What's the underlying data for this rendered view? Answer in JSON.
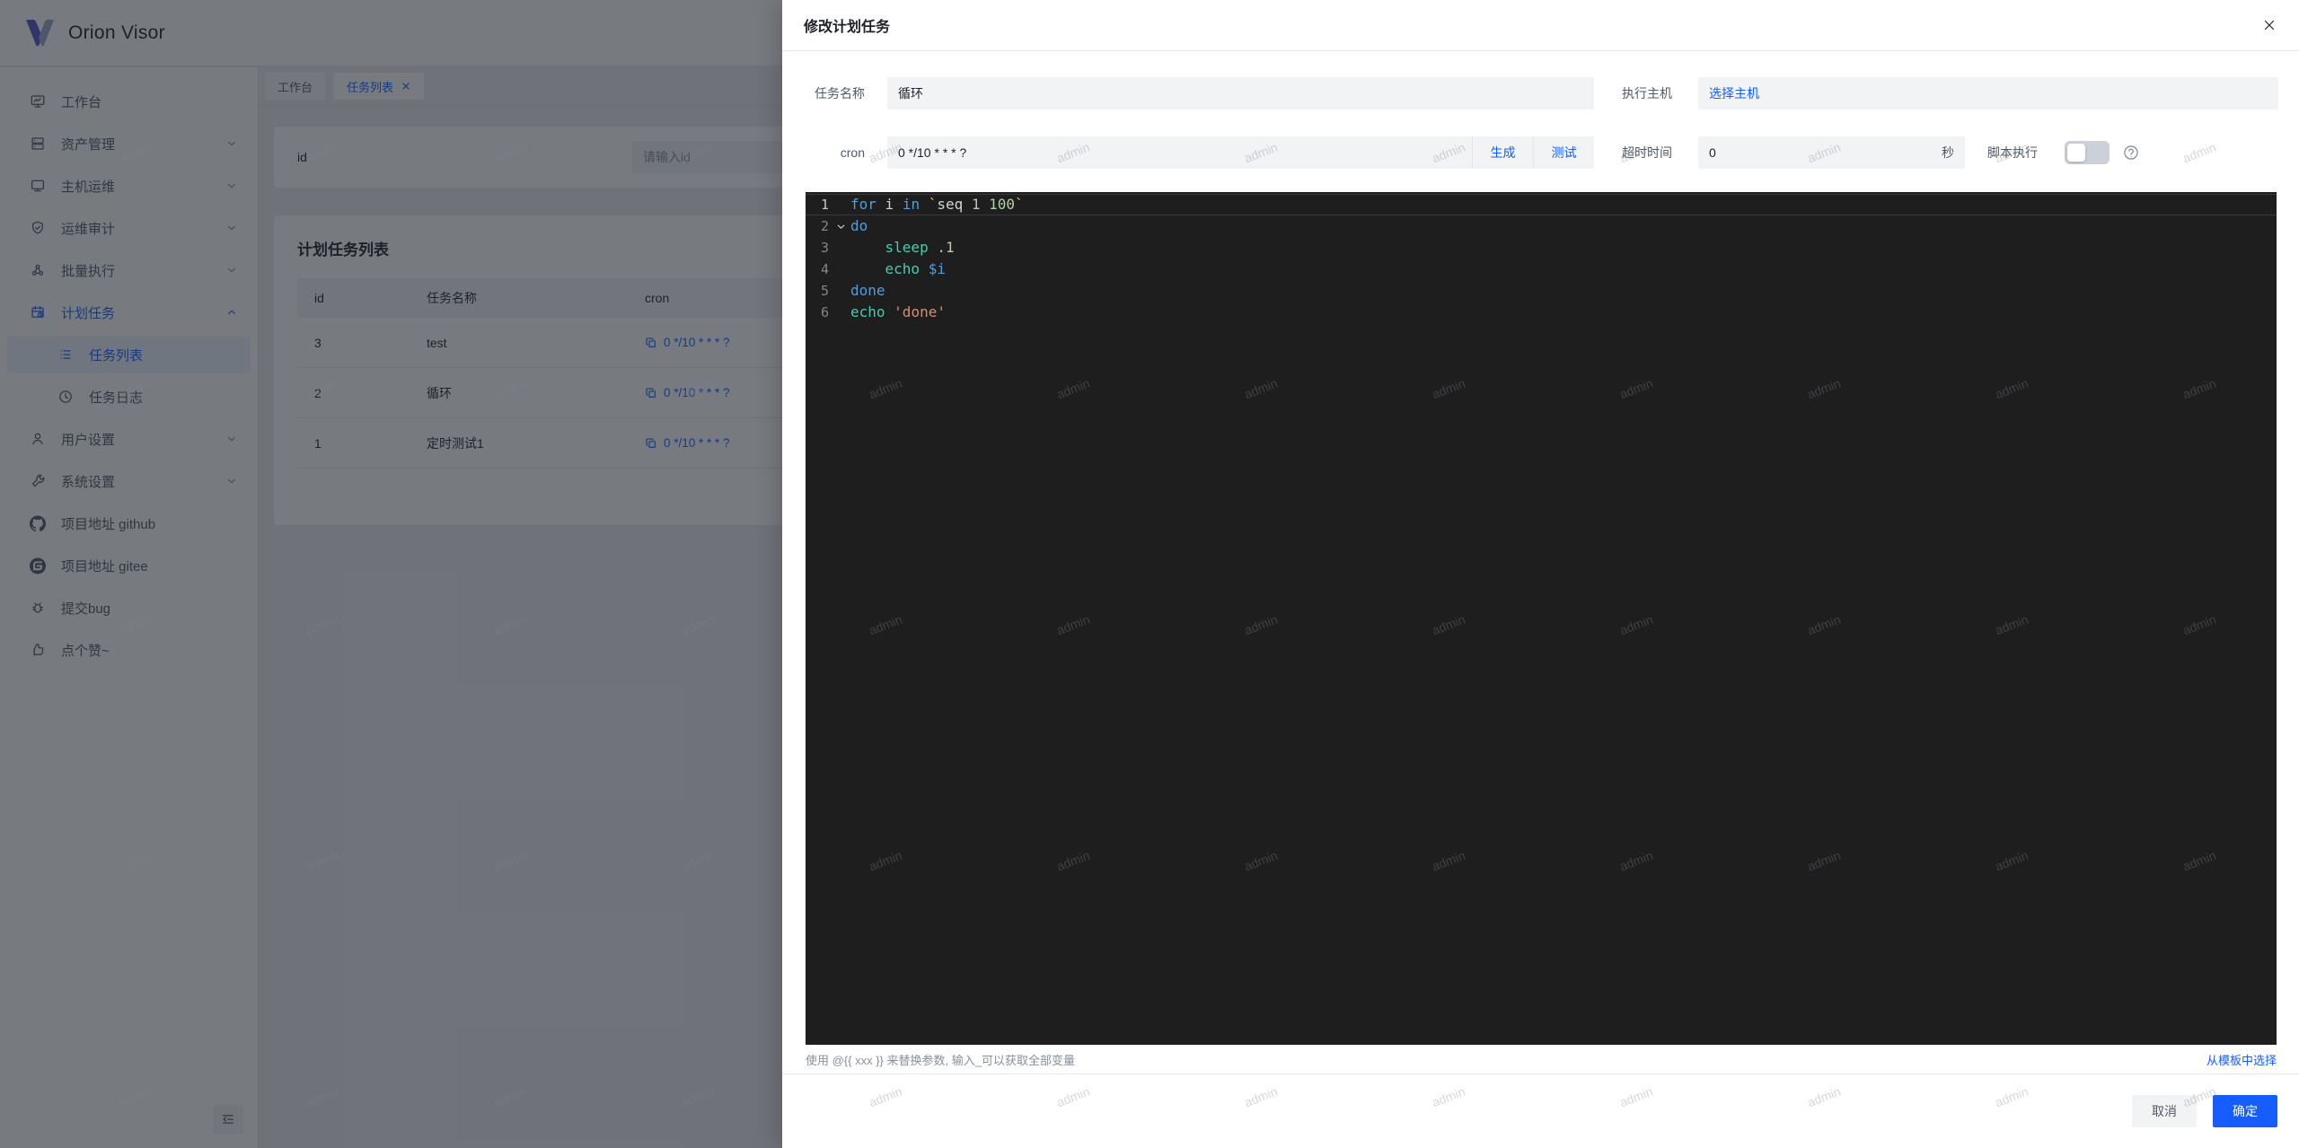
{
  "app": {
    "name": "Orion Visor"
  },
  "watermark": {
    "text": "admin"
  },
  "sidebar": {
    "items": [
      {
        "key": "workbench",
        "label": "工作台",
        "icon": "dashboard-icon",
        "chevron": null,
        "blue": false,
        "sub": false,
        "selected": false
      },
      {
        "key": "assets",
        "label": "资产管理",
        "icon": "asset-server-icon",
        "chevron": "down",
        "blue": false,
        "sub": false,
        "selected": false
      },
      {
        "key": "host-ops",
        "label": "主机运维",
        "icon": "host-monitor-icon",
        "chevron": "down",
        "blue": false,
        "sub": false,
        "selected": false
      },
      {
        "key": "audit",
        "label": "运维审计",
        "icon": "shield-check-icon",
        "chevron": "down",
        "blue": false,
        "sub": false,
        "selected": false
      },
      {
        "key": "batch-exec",
        "label": "批量执行",
        "icon": "batch-nodes-icon",
        "chevron": "down",
        "blue": false,
        "sub": false,
        "selected": false
      },
      {
        "key": "schedule",
        "label": "计划任务",
        "icon": "calendar-clock-icon",
        "chevron": "up",
        "blue": true,
        "sub": false,
        "selected": false
      },
      {
        "key": "task-list",
        "label": "任务列表",
        "icon": "list-icon",
        "chevron": null,
        "blue": true,
        "sub": true,
        "selected": true
      },
      {
        "key": "task-log",
        "label": "任务日志",
        "icon": "history-clock-icon",
        "chevron": null,
        "blue": false,
        "sub": true,
        "selected": false
      },
      {
        "key": "user-settings",
        "label": "用户设置",
        "icon": "user-icon",
        "chevron": "down",
        "blue": false,
        "sub": false,
        "selected": false
      },
      {
        "key": "sys-settings",
        "label": "系统设置",
        "icon": "wrench-icon",
        "chevron": "down",
        "blue": false,
        "sub": false,
        "selected": false
      },
      {
        "key": "github",
        "label": "项目地址 github",
        "icon": "github-icon",
        "chevron": null,
        "blue": false,
        "sub": false,
        "selected": false
      },
      {
        "key": "gitee",
        "label": "项目地址 gitee",
        "icon": "gitee-icon",
        "chevron": null,
        "blue": false,
        "sub": false,
        "selected": false
      },
      {
        "key": "report-bug",
        "label": "提交bug",
        "icon": "bug-icon",
        "chevron": null,
        "blue": false,
        "sub": false,
        "selected": false
      },
      {
        "key": "like",
        "label": "点个赞~",
        "icon": "thumbs-up-icon",
        "chevron": null,
        "blue": false,
        "sub": false,
        "selected": false
      }
    ]
  },
  "tabs": [
    {
      "label": "工作台",
      "active": false,
      "closable": false
    },
    {
      "label": "任务列表",
      "active": true,
      "closable": true
    }
  ],
  "filter": {
    "label": "id",
    "placeholder": "请输入id"
  },
  "table": {
    "title": "计划任务列表",
    "columns": [
      "id",
      "任务名称",
      "cron"
    ],
    "rows": [
      {
        "id": "3",
        "name": "test",
        "cron": "0 */10 * * * ?"
      },
      {
        "id": "2",
        "name": "循环",
        "cron": "0 */10 * * * ?"
      },
      {
        "id": "1",
        "name": "定时测试1",
        "cron": "0 */10 * * * ?"
      }
    ]
  },
  "modal": {
    "title": "修改计划任务",
    "fields": {
      "name_label": "任务名称",
      "name_value": "循环",
      "host_label": "执行主机",
      "host_link": "选择主机",
      "cron_label": "cron",
      "cron_value": "0 */10 * * * ?",
      "generate_label": "生成",
      "test_label": "测试",
      "timeout_label": "超时时间",
      "timeout_value": "0",
      "timeout_unit": "秒",
      "script_label": "脚本执行"
    },
    "editor": {
      "lines": [
        {
          "n": "1",
          "current": true,
          "fold": false,
          "tokens": [
            [
              "kw",
              "for"
            ],
            [
              "pl",
              " i "
            ],
            [
              "kw",
              "in"
            ],
            [
              "pl",
              " "
            ],
            [
              "bt",
              "`"
            ],
            [
              "pl",
              "seq"
            ],
            [
              "nu",
              " 1 100"
            ],
            [
              "bt",
              "`"
            ]
          ]
        },
        {
          "n": "2",
          "current": false,
          "fold": true,
          "tokens": [
            [
              "kw",
              "do"
            ]
          ]
        },
        {
          "n": "3",
          "current": false,
          "fold": false,
          "tokens": [
            [
              "pl",
              "    "
            ],
            [
              "fn",
              "sleep"
            ],
            [
              "nu",
              " .1"
            ]
          ]
        },
        {
          "n": "4",
          "current": false,
          "fold": false,
          "tokens": [
            [
              "pl",
              "    "
            ],
            [
              "fn",
              "echo"
            ],
            [
              "va",
              " $i"
            ]
          ]
        },
        {
          "n": "5",
          "current": false,
          "fold": false,
          "tokens": [
            [
              "kw",
              "done"
            ]
          ]
        },
        {
          "n": "6",
          "current": false,
          "fold": false,
          "tokens": [
            [
              "fn",
              "echo"
            ],
            [
              "pl",
              " "
            ],
            [
              "st",
              "'done'"
            ]
          ]
        }
      ]
    },
    "hint": "使用 @{{ xxx }} 来替换参数, 输入_可以获取全部变量",
    "template_link": "从模板中选择",
    "cancel_label": "取消",
    "ok_label": "确定"
  },
  "colors": {
    "accent": "#165dff",
    "text_primary": "#1d2129",
    "text_secondary": "#4e5969",
    "placeholder": "#86909c",
    "field_fill": "#f2f3f5",
    "border": "#e5e6eb",
    "editor_bg": "#1e1e1e"
  }
}
